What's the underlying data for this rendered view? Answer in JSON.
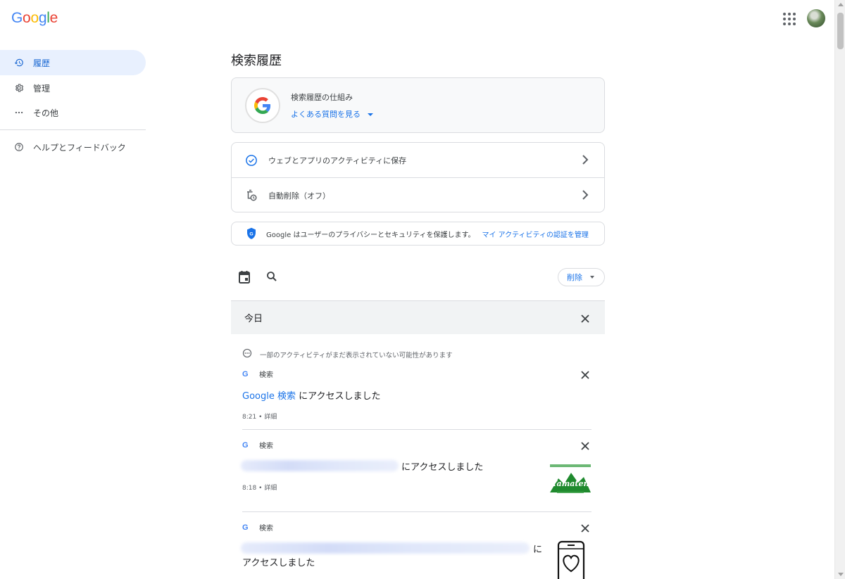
{
  "header": {
    "logo_letters": [
      "G",
      "o",
      "o",
      "g",
      "l",
      "e"
    ],
    "logo_colors": [
      "#4285f4",
      "#ea4335",
      "#fbbc05",
      "#4285f4",
      "#34a853",
      "#ea4335"
    ],
    "apps_icon": "apps-grid-icon",
    "avatar_icon": "account-avatar"
  },
  "sidebar": {
    "items": [
      {
        "label": "履歴",
        "icon": "history-icon",
        "active": true
      },
      {
        "label": "管理",
        "icon": "gear-icon",
        "active": false
      },
      {
        "label": "その他",
        "icon": "more-horiz-icon",
        "active": false
      },
      {
        "label": "ヘルプとフィードバック",
        "icon": "help-icon",
        "active": false
      }
    ]
  },
  "main": {
    "title": "検索履歴",
    "info_card": {
      "title": "検索履歴の仕組み",
      "link": "よくある質問を見る"
    },
    "settings": [
      {
        "label": "ウェブとアプリのアクティビティに保存",
        "icon": "check-circle-icon"
      },
      {
        "label": "自動削除（オフ）",
        "icon": "auto-delete-icon"
      }
    ],
    "privacy": {
      "text": "Google はユーザーのプライバシーとセキュリティを保護します。",
      "link": "マイ アクティビティの認証を管理"
    },
    "toolbar": {
      "delete_label": "削除"
    },
    "day": {
      "label": "今日",
      "notice": "一部のアクティビティがまだ表示されていない可能性があります"
    },
    "entries": [
      {
        "source": "検索",
        "title_link": "Google 検索",
        "title_suffix": " にアクセスしました",
        "time": "8:21",
        "detail": "詳細"
      },
      {
        "source": "検索",
        "title_suffix": "にアクセスしました",
        "time": "8:18",
        "detail": "詳細",
        "thumbnail_text": "Yamaten"
      },
      {
        "source": "検索",
        "title_suffix_line1": "に",
        "title_suffix_line2": "アクセスしました"
      }
    ]
  },
  "colors": {
    "accent": "#1a73e8",
    "active_nav_bg": "#e8f0fe",
    "day_header_bg": "#f1f3f4"
  }
}
